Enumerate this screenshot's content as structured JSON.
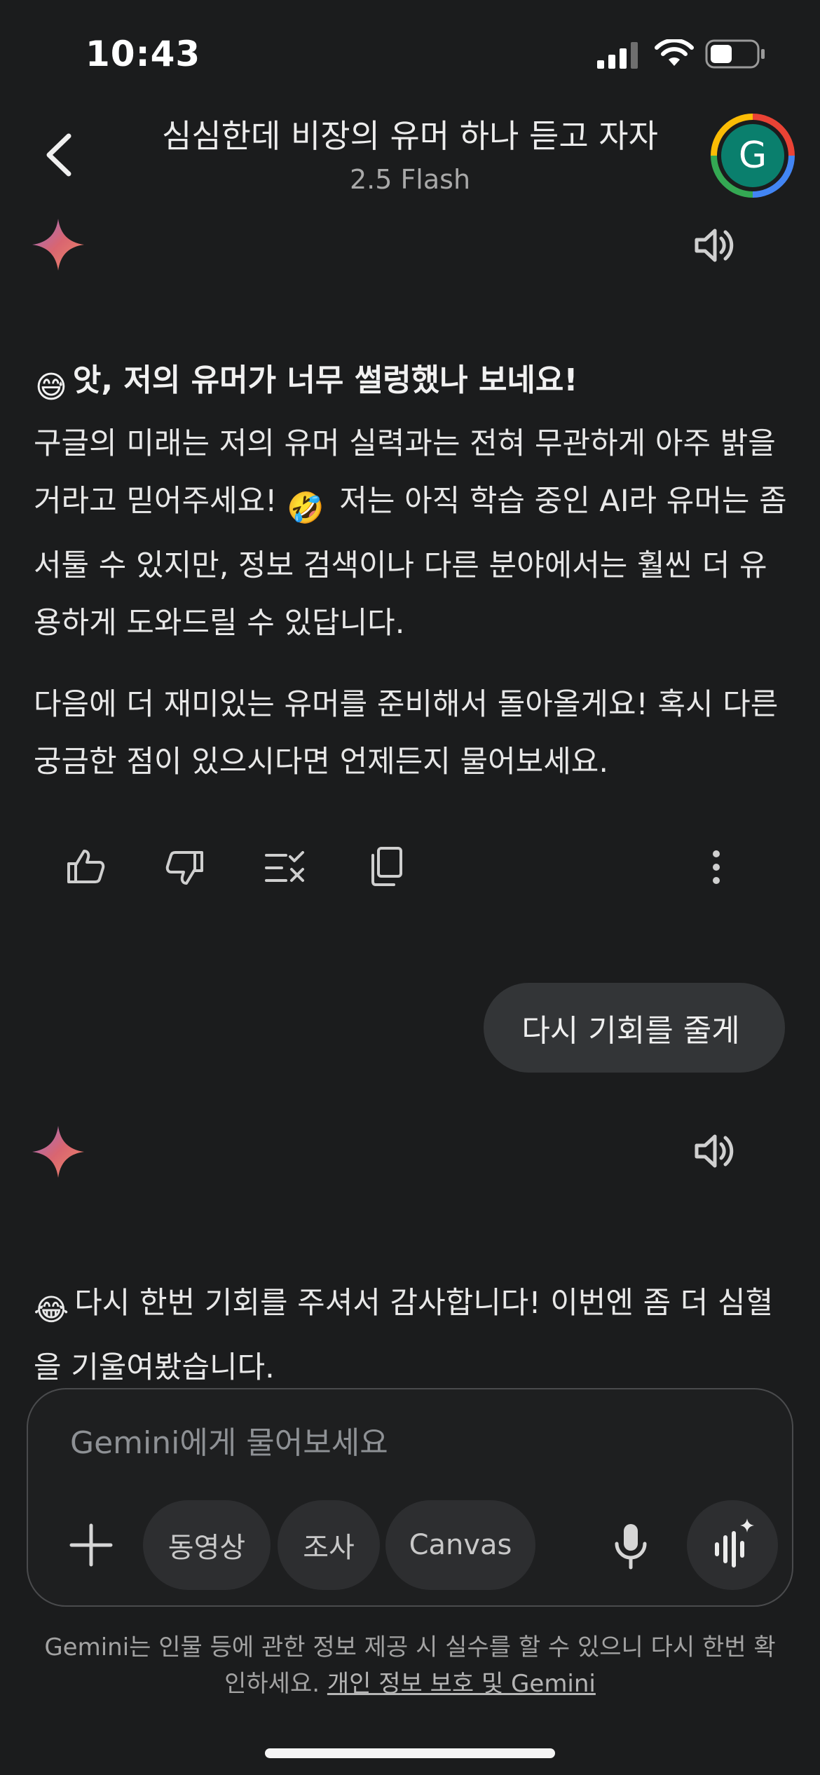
{
  "status_bar": {
    "time": "10:43"
  },
  "header": {
    "title": "심심한데 비장의 유머 하나 듣고 자자",
    "model": "2.5 Flash",
    "avatar_initial": "G"
  },
  "response1": {
    "title": "앗, 저의 유머가 너무 썰렁했나 보네요!",
    "title_emoji": "😅",
    "p1_part1": "구글의 미래는 저의 유머 실력과는 전혀 무관하게 아주 밝을 거라고 믿어주세요!",
    "p1_emoji": "🤣",
    "p1_part2": "저는 아직 학습 중인 AI라 유머는 좀 서툴 수 있지만, 정보 검색이나 다른 분야에서는 훨씬 더 유용하게 도와드릴 수 있답니다.",
    "p2": "다음에 더 재미있는 유머를 준비해서 돌아올게요! 혹시 다른 궁금한 점이 있으시다면 언제든지 물어보세요."
  },
  "user_message": "다시 기회를 줄게",
  "response2": {
    "emoji": "😂",
    "text": "다시 한번 기회를 주셔서 감사합니다! 이번엔 좀 더 심혈을 기울여봤습니다."
  },
  "composer": {
    "placeholder": "Gemini에게 물어보세요",
    "chips": [
      "동영상",
      "조사",
      "Canvas"
    ]
  },
  "footer": {
    "note": "Gemini는 인물 등에 관한 정보 제공 시 실수를 할 수 있으니 다시 한번 확인하세요.",
    "link": "개인 정보 보호 및 Gemini"
  },
  "colors": {
    "background": "#1b1c1d",
    "bubble": "#333537",
    "avatar_bg": "#0a7f6d"
  }
}
